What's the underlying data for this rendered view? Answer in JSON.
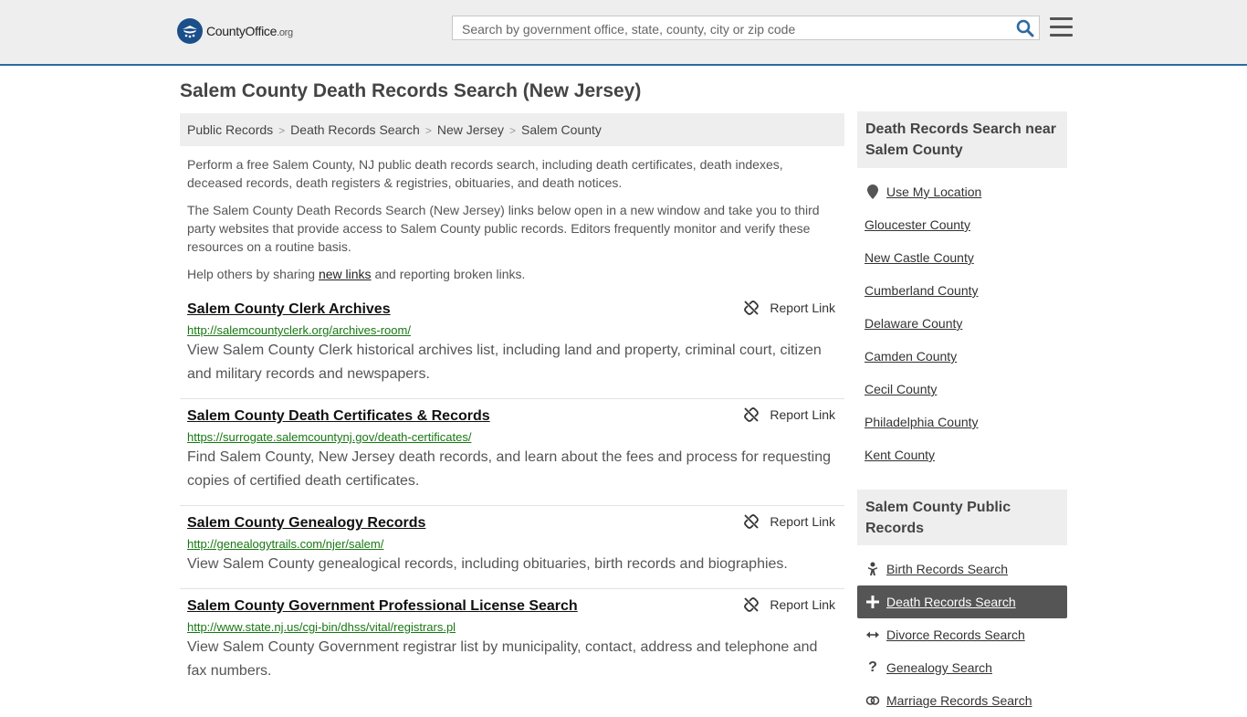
{
  "header": {
    "logo_main": "CountyOffice",
    "logo_suffix": ".org",
    "search_placeholder": "Search by government office, state, county, city or zip code"
  },
  "page": {
    "title": "Salem County Death Records Search (New Jersey)"
  },
  "breadcrumb": [
    "Public Records",
    "Death Records Search",
    "New Jersey",
    "Salem County"
  ],
  "intro": {
    "p1": "Perform a free Salem County, NJ public death records search, including death certificates, death indexes, deceased records, death registers & registries, obituaries, and death notices.",
    "p2": "The Salem County Death Records Search (New Jersey) links below open in a new window and take you to third party websites that provide access to Salem County public records. Editors frequently monitor and verify these resources on a routine basis.",
    "p3_before": "Help others by sharing",
    "p3_link": "new links",
    "p3_after": "and reporting broken links."
  },
  "report_label": "Report Link",
  "results": [
    {
      "title": "Salem County Clerk Archives",
      "url": "http://salemcountyclerk.org/archives-room/",
      "desc": "View Salem County Clerk historical archives list, including land and property, criminal court, citizen and military records and newspapers."
    },
    {
      "title": "Salem County Death Certificates & Records",
      "url": "https://surrogate.salemcountynj.gov/death-certificates/",
      "desc": "Find Salem County, New Jersey death records, and learn about the fees and process for requesting copies of certified death certificates."
    },
    {
      "title": "Salem County Genealogy Records",
      "url": "http://genealogytrails.com/njer/salem/",
      "desc": "View Salem County genealogical records, including obituaries, birth records and biographies."
    },
    {
      "title": "Salem County Government Professional License Search",
      "url": "http://www.state.nj.us/cgi-bin/dhss/vital/registrars.pl",
      "desc": "View Salem County Government registrar list by municipality, contact, address and telephone and fax numbers."
    }
  ],
  "sidebar": {
    "nearby_heading": "Death Records Search near Salem County",
    "use_location": "Use My Location",
    "nearby": [
      "Gloucester County",
      "New Castle County",
      "Cumberland County",
      "Delaware County",
      "Camden County",
      "Cecil County",
      "Philadelphia County",
      "Kent County"
    ],
    "records_heading": "Salem County Public Records",
    "records": [
      {
        "label": "Birth Records Search",
        "icon": "baby-icon"
      },
      {
        "label": "Death Records Search",
        "icon": "cross-icon"
      },
      {
        "label": "Divorce Records Search",
        "icon": "arrows-split-icon"
      },
      {
        "label": "Genealogy Search",
        "icon": "question-icon"
      },
      {
        "label": "Marriage Records Search",
        "icon": "rings-icon"
      }
    ]
  },
  "colors": {
    "accent_border": "#2c6aa0",
    "url_green": "#177812",
    "active_item_bg": "#555555"
  }
}
